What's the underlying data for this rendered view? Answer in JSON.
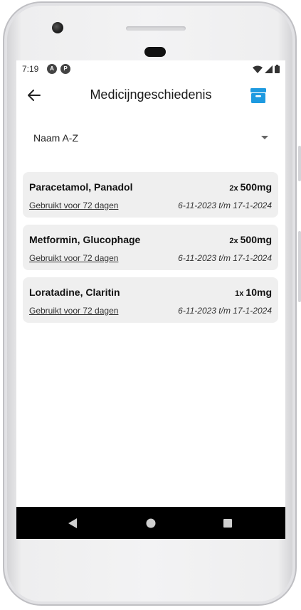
{
  "status_bar": {
    "time": "7:19",
    "icons": [
      "notification-a-icon",
      "notification-p-icon",
      "wifi-icon",
      "signal-icon",
      "battery-icon"
    ]
  },
  "app_bar": {
    "title": "Medicijngeschiedenis",
    "back_icon": "arrow-left-icon",
    "action_icon": "archive-icon",
    "accent_color": "#1e9ae0"
  },
  "sort": {
    "selected": "Naam A-Z"
  },
  "medications": [
    {
      "name": "Paracetamol, Panadol",
      "times": "2x",
      "dose": "500mg",
      "used_label": "Gebruikt voor 72 dagen",
      "dates": "6-11-2023 t/m 17-1-2024"
    },
    {
      "name": "Metformin, Glucophage",
      "times": "2x",
      "dose": "500mg",
      "used_label": "Gebruikt voor 72 dagen",
      "dates": "6-11-2023 t/m 17-1-2024"
    },
    {
      "name": "Loratadine, Claritin",
      "times": "1x",
      "dose": "10mg",
      "used_label": "Gebruikt voor 72 dagen",
      "dates": "6-11-2023 t/m 17-1-2024"
    }
  ],
  "nav_bar": {
    "icons": [
      "back-triangle-icon",
      "home-circle-icon",
      "recents-square-icon"
    ]
  }
}
